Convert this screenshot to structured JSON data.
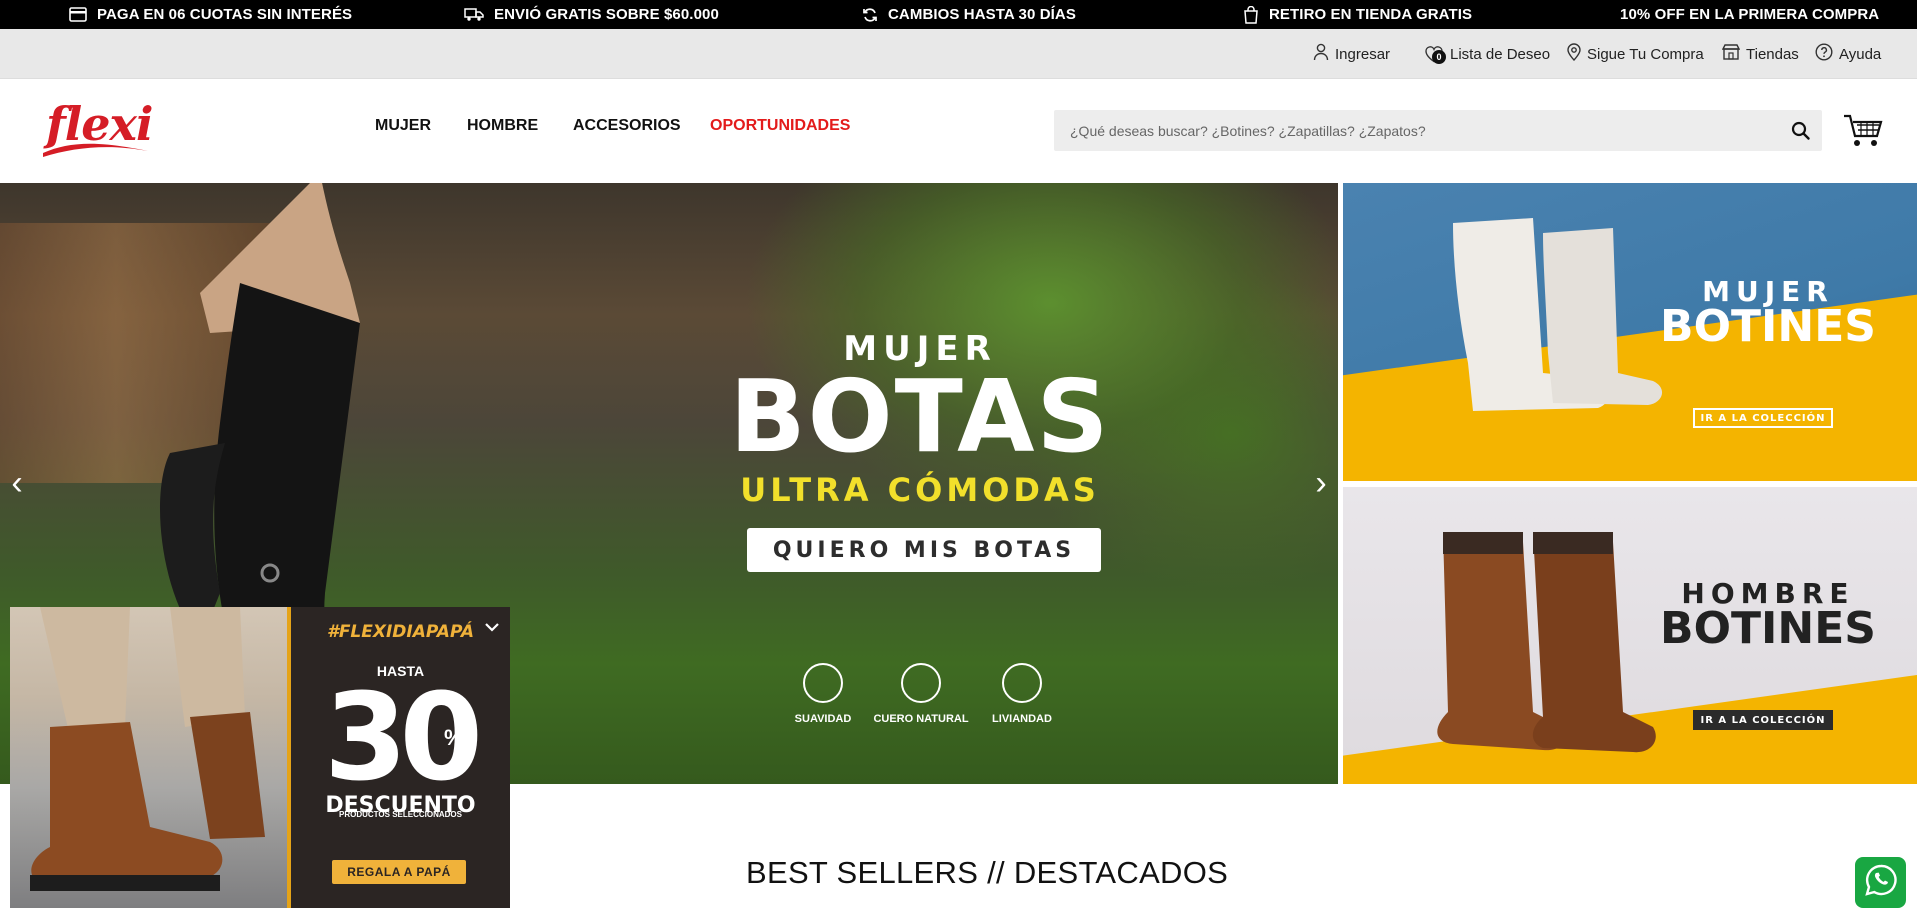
{
  "promo_bar": {
    "items": [
      {
        "icon": "card-icon",
        "label": "PAGA EN 06 CUOTAS SIN INTERÉS"
      },
      {
        "icon": "truck-icon",
        "label": "ENVIÓ GRATIS SOBRE $60.000"
      },
      {
        "icon": "refresh-icon",
        "label": "CAMBIOS HASTA 30 DÍAS"
      },
      {
        "icon": "bag-icon",
        "label": "RETIRO EN TIENDA GRATIS"
      },
      {
        "icon": "",
        "label": "10% OFF EN LA PRIMERA COMPRA"
      }
    ]
  },
  "utility_bar": {
    "login": "Ingresar",
    "wishlist": "Lista de Deseo",
    "wishlist_count": "0",
    "track_order": "Sigue Tu Compra",
    "stores": "Tiendas",
    "help": "Ayuda"
  },
  "header": {
    "logo_text": "flexi",
    "nav": [
      "MUJER",
      "HOMBRE",
      "ACCESORIOS",
      "OPORTUNIDADES"
    ],
    "search_placeholder": "¿Qué deseas buscar? ¿Botines? ¿Zapatillas? ¿Zapatos?",
    "highlight_color": "#e31b1b"
  },
  "hero": {
    "subtitle": "MUJER",
    "title": "BOTAS",
    "tagline": "ULTRA CÓMODAS",
    "cta": "QUIERO MIS BOTAS",
    "features": [
      "SUAVIDAD",
      "CUERO NATURAL",
      "LIVIANDAD"
    ],
    "features_icons": [
      "cloud-icon",
      "leather-icon",
      "feather-icon"
    ],
    "tagline_color": "#f2e02b"
  },
  "side_banners": [
    {
      "subtitle": "MUJER",
      "title": "BOTINES",
      "cta": "IR A LA COLECCIÓN"
    },
    {
      "subtitle": "HOMBRE",
      "title": "BOTINES",
      "cta": "IR A LA COLECCIÓN"
    }
  ],
  "popup": {
    "hashtag": "#FLEXIDIAPAPÁ",
    "upto": "HASTA",
    "value": "30",
    "unit": "%",
    "label": "DESCUENTO",
    "sublabel": "PRODUCTOS SELECCIONADOS",
    "cta": "REGALA A PAPÁ",
    "accent": "#f0b23a"
  },
  "sections": {
    "best_sellers": "BEST SELLERS // DESTACADOS"
  },
  "whatsapp": {
    "icon": "whatsapp-icon",
    "color": "#19a742"
  }
}
